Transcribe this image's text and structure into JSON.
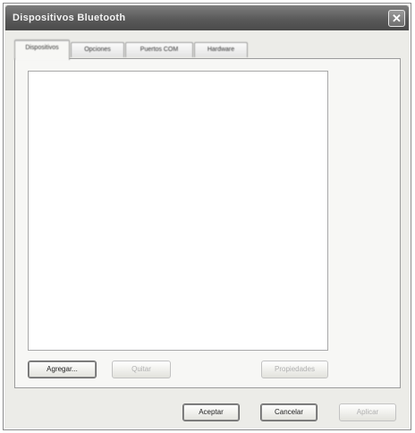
{
  "window": {
    "title": "Dispositivos Bluetooth"
  },
  "tabs": [
    {
      "label": "Dispositivos",
      "active": true
    },
    {
      "label": "Opciones",
      "active": false
    },
    {
      "label": "Puertos COM",
      "active": false
    },
    {
      "label": "Hardware",
      "active": false
    }
  ],
  "devices": {
    "items": []
  },
  "buttons": {
    "add": "Agregar...",
    "remove": "Quitar",
    "properties": "Propiedades",
    "ok": "Aceptar",
    "cancel": "Cancelar",
    "apply": "Aplicar"
  },
  "icons": {
    "close": "close-icon"
  }
}
